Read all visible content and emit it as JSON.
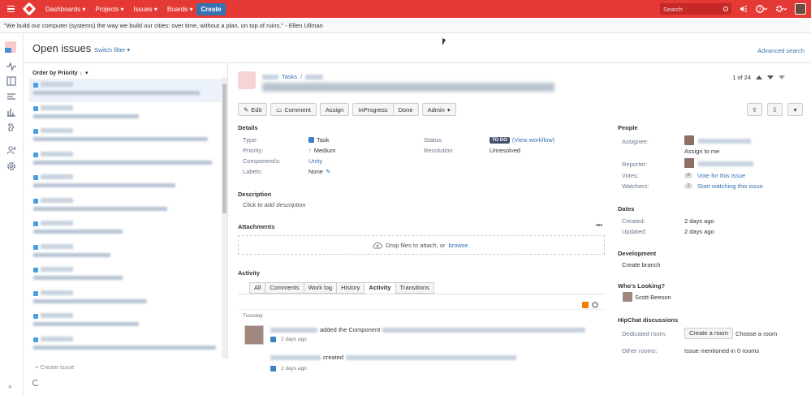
{
  "topbar": {
    "nav": [
      "Dashboards",
      "Projects",
      "Issues",
      "Boards"
    ],
    "create_label": "Create",
    "search_placeholder": "Search"
  },
  "quote": "\"We build our computer (systems) the way we build our cities: over time, without a plan, on top of ruins.\" - Ellen Ullman",
  "page": {
    "title": "Open issues",
    "switch_filter": "Switch filter",
    "advanced_search": "Advanced search"
  },
  "list": {
    "order_label": "Order by Priority",
    "create_issue": "+ Create issue"
  },
  "issue": {
    "breadcrumb_tasks": "Tasks",
    "pager": "1 of 24",
    "buttons": {
      "edit": "Edit",
      "comment": "Comment",
      "assign": "Assign",
      "inprogress": "InProgress",
      "done": "Done",
      "admin": "Admin"
    },
    "details": {
      "section": "Details",
      "type_label": "Type:",
      "type_value": "Task",
      "priority_label": "Priority:",
      "priority_value": "Medium",
      "components_label": "Component/s:",
      "components_value": "Unity",
      "labels_label": "Labels:",
      "labels_value": "None",
      "status_label": "Status:",
      "status_value": "TO DO",
      "view_workflow": "(View workflow)",
      "resolution_label": "Resolution:",
      "resolution_value": "Unresolved"
    },
    "description": {
      "section": "Description",
      "placeholder": "Click to add description"
    },
    "attachments": {
      "section": "Attachments",
      "drop_text": "Drop files to attach, or",
      "browse": "browse."
    },
    "activity": {
      "section": "Activity",
      "tabs": [
        "All",
        "Comments",
        "Work log",
        "History",
        "Activity",
        "Transitions"
      ],
      "active_tab": "Activity",
      "day": "Tuesday",
      "entry1_action": "added the Component",
      "entry1_time": "2 days ago",
      "entry2_action": "created",
      "entry2_time": "2 days ago"
    }
  },
  "people": {
    "section": "People",
    "assignee_label": "Assignee:",
    "assign_to_me": "Assign to me",
    "reporter_label": "Reporter:",
    "votes_label": "Votes:",
    "votes_count": "0",
    "vote_link": "Vote for this issue",
    "watchers_label": "Watchers:",
    "watchers_count": "1",
    "watch_link": "Start watching this issue"
  },
  "dates": {
    "section": "Dates",
    "created_label": "Created:",
    "created_value": "2 days ago",
    "updated_label": "Updated:",
    "updated_value": "2 days ago"
  },
  "development": {
    "section": "Development",
    "create_branch": "Create branch"
  },
  "looking": {
    "section": "Who's Looking?",
    "user": "Scott Beeson"
  },
  "hipchat": {
    "section": "HipChat discussions",
    "dedicated_label": "Dedicated room:",
    "create_room": "Create a room",
    "choose_room": "Choose a room",
    "other_label": "Other rooms:",
    "other_value": "Issue mentioned in 0 rooms"
  },
  "colors": {
    "topbar": "#e53935",
    "link": "#3572b0",
    "create": "#3572b0"
  }
}
